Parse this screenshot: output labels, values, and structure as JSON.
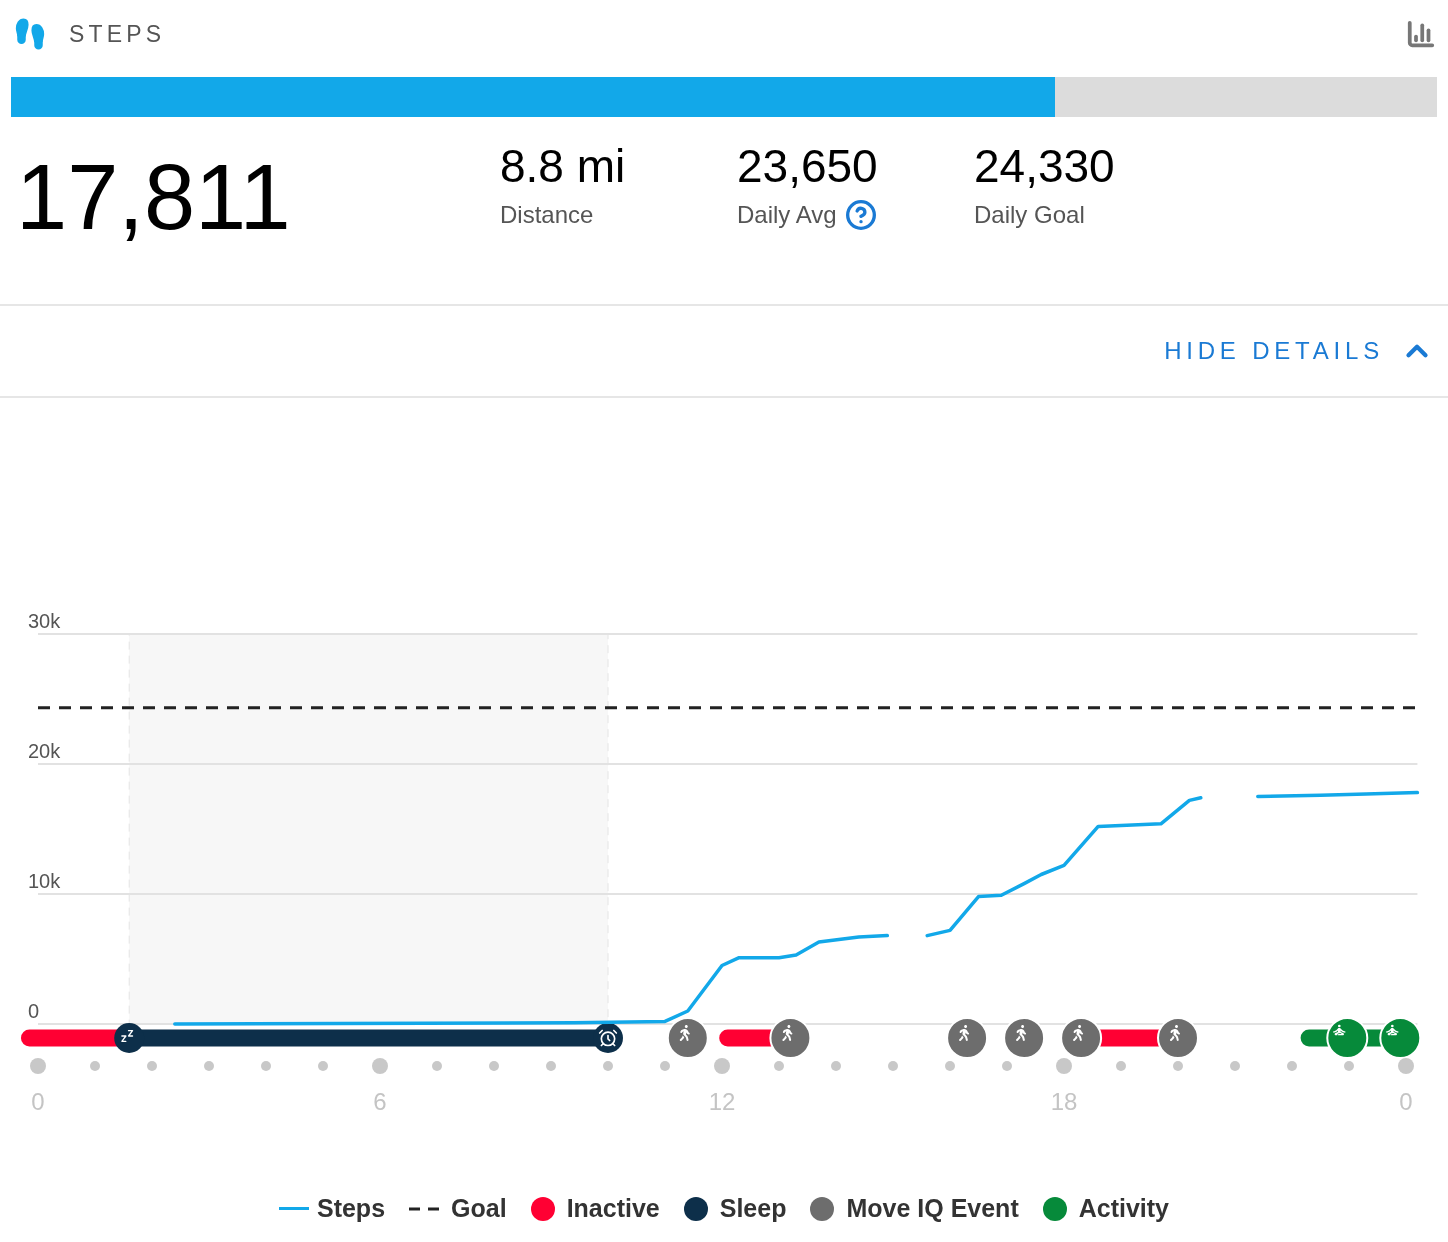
{
  "header": {
    "title": "STEPS"
  },
  "progress": {
    "level": 0.732
  },
  "total": "17,811",
  "stats": [
    {
      "value": "8.8 mi",
      "label": "Distance",
      "help": false
    },
    {
      "value": "23,650",
      "label": "Daily Avg",
      "help": true
    },
    {
      "value": "24,330",
      "label": "Daily Goal",
      "help": false
    }
  ],
  "details_toggle": {
    "label": "HIDE DETAILS",
    "expanded": true
  },
  "chart_data": {
    "type": "line",
    "xlim": [
      0,
      24.2
    ],
    "ylim": [
      0,
      30000
    ],
    "xticks": [
      0,
      6,
      12,
      18
    ],
    "yticks": [
      {
        "value": 0,
        "label": "0"
      },
      {
        "value": 10000,
        "label": "10k"
      },
      {
        "value": 20000,
        "label": "20k"
      },
      {
        "value": 30000,
        "label": "30k"
      }
    ],
    "x": [
      2.4,
      9.4,
      11,
      11.4,
      12,
      12.3,
      13,
      13.3,
      13.7,
      14.4,
      14.9,
      15.2,
      15.6,
      16,
      16.5,
      16.9,
      17.3,
      17.6,
      18,
      18.6,
      19.7,
      20.2,
      20.4,
      20.9,
      21.4,
      22.5,
      23.3,
      24.2
    ],
    "series": [
      {
        "name": "Steps",
        "color": "#12a8e9",
        "values": [
          0,
          100,
          200,
          1000,
          4500,
          5100,
          5100,
          5300,
          6300,
          6700,
          6800,
          null,
          6800,
          7200,
          9800,
          9900,
          10800,
          11500,
          12200,
          15200,
          15400,
          17200,
          17400,
          null,
          17500,
          17600,
          17700,
          17800
        ]
      }
    ],
    "ref_lines": [
      {
        "axis": "y",
        "value": 24330,
        "label": "Goal"
      }
    ],
    "bands": [
      {
        "axis": "x",
        "from": 1.6,
        "to": 10
      }
    ]
  },
  "axis_end_label": "0",
  "timeline": [
    {
      "kind": "inactive"
    },
    {
      "kind": "sleep"
    },
    {
      "kind": "inactive"
    },
    {
      "kind": "inactive"
    },
    {
      "kind": "activity"
    },
    {
      "kind": "sleep_start"
    },
    {
      "kind": "wake"
    },
    {
      "kind": "move_iq"
    },
    {
      "kind": "move_iq"
    },
    {
      "kind": "move_iq"
    },
    {
      "kind": "move_iq"
    },
    {
      "kind": "move_iq"
    },
    {
      "kind": "move_iq"
    },
    {
      "kind": "activity_start"
    },
    {
      "kind": "activity_start"
    }
  ],
  "legend": [
    {
      "kind": "series"
    },
    {
      "kind": "ref_line"
    },
    {
      "label": "Inactive",
      "kind": "dot",
      "color": "#ff0033"
    },
    {
      "label": "Sleep",
      "kind": "dot",
      "color": "#0d2f4a"
    },
    {
      "label": "Move IQ Event",
      "kind": "dot",
      "color": "#6d6d6d"
    },
    {
      "label": "Activity",
      "kind": "dot",
      "color": "#068a3a"
    }
  ]
}
